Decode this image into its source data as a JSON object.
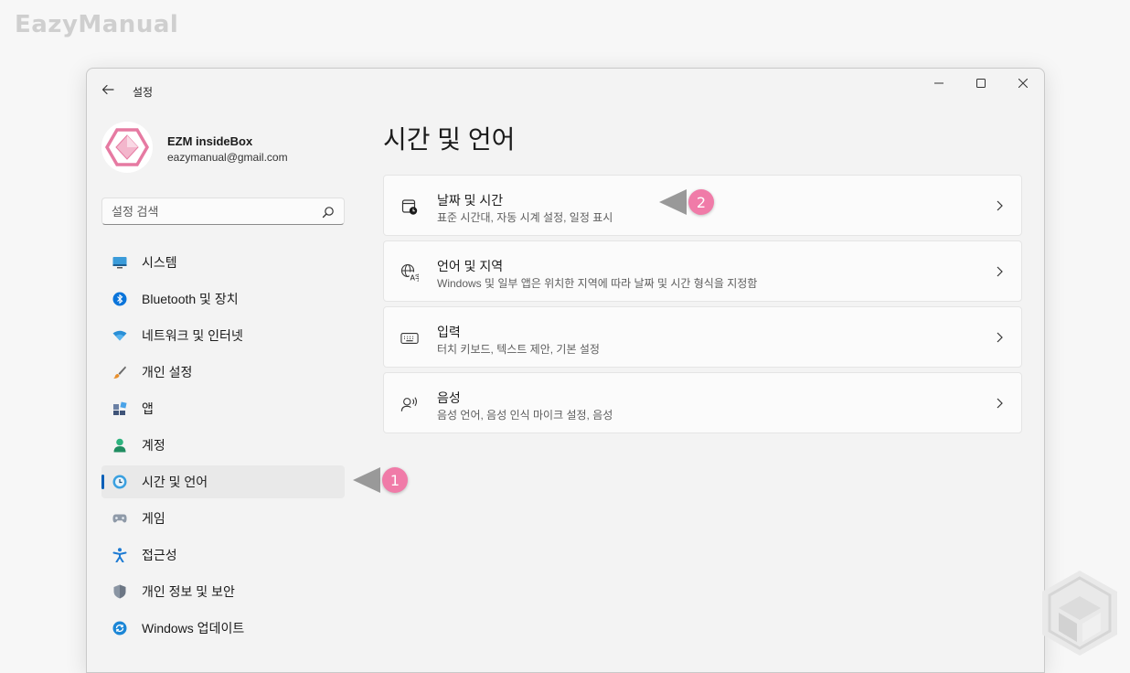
{
  "watermark": {
    "text": "EazyManual"
  },
  "window": {
    "title": "설정",
    "controls": {
      "minimize": "minimize",
      "maximize": "maximize",
      "close": "close"
    }
  },
  "profile": {
    "name": "EZM insideBox",
    "email": "eazymanual@gmail.com"
  },
  "search": {
    "placeholder": "설정 검색"
  },
  "sidebar": {
    "items": [
      {
        "label": "시스템",
        "icon": "monitor-icon"
      },
      {
        "label": "Bluetooth 및 장치",
        "icon": "bluetooth-icon"
      },
      {
        "label": "네트워크 및 인터넷",
        "icon": "wifi-icon"
      },
      {
        "label": "개인 설정",
        "icon": "brush-icon"
      },
      {
        "label": "앱",
        "icon": "apps-icon"
      },
      {
        "label": "계정",
        "icon": "person-icon"
      },
      {
        "label": "시간 및 언어",
        "icon": "globe-clock-icon",
        "active": true
      },
      {
        "label": "게임",
        "icon": "gamepad-icon"
      },
      {
        "label": "접근성",
        "icon": "accessibility-icon"
      },
      {
        "label": "개인 정보 및 보안",
        "icon": "shield-icon"
      },
      {
        "label": "Windows 업데이트",
        "icon": "update-icon"
      }
    ]
  },
  "main": {
    "title": "시간 및 언어",
    "cards": [
      {
        "title": "날짜 및 시간",
        "desc": "표준 시간대, 자동 시계 설정, 일정 표시",
        "icon": "calendar-clock-icon"
      },
      {
        "title": "언어 및 지역",
        "desc": "Windows 및 일부 앱은 위치한 지역에 따라 날짜 및 시간 형식을 지정함",
        "icon": "language-icon"
      },
      {
        "title": "입력",
        "desc": "터치 키보드, 텍스트 제안, 기본 설정",
        "icon": "keyboard-icon"
      },
      {
        "title": "음성",
        "desc": "음성 언어, 음성 인식 마이크 설정, 음성",
        "icon": "speech-icon"
      }
    ]
  },
  "annotations": {
    "step1": "1",
    "step2": "2"
  },
  "colors": {
    "accent": "#005fb8",
    "badge": "#f07ba8",
    "arrow": "#999999"
  }
}
